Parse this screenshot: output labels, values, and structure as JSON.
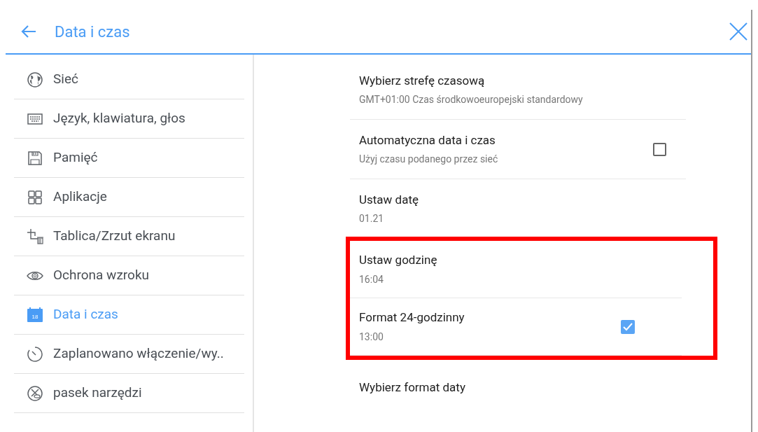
{
  "header": {
    "title": "Data i czas"
  },
  "sidebar": {
    "items": [
      {
        "label": "Sieć",
        "selected": false
      },
      {
        "label": "Język, klawiatura, głos",
        "selected": false
      },
      {
        "label": "Pamięć",
        "selected": false
      },
      {
        "label": "Aplikacje",
        "selected": false
      },
      {
        "label": "Tablica/Zrzut ekranu",
        "selected": false
      },
      {
        "label": "Ochrona wzroku",
        "selected": false
      },
      {
        "label": "Data i czas",
        "selected": true,
        "icon_text": "18"
      },
      {
        "label": "Zaplanowano włączenie/wy..",
        "selected": false
      },
      {
        "label": "pasek narzędzi",
        "selected": false
      }
    ]
  },
  "settings": [
    {
      "kind": "text",
      "title": "Wybierz strefę czasową",
      "subtitle": "GMT+01:00 Czas środkowoeuropejski standardowy",
      "highlighted": false
    },
    {
      "kind": "checkbox",
      "title": "Automatyczna data i czas",
      "subtitle": "Użyj czasu podanego przez sieć",
      "checked": false,
      "highlighted": false
    },
    {
      "kind": "text",
      "title": "Ustaw datę",
      "subtitle": "01.21",
      "highlighted": false
    },
    {
      "kind": "text",
      "title": "Ustaw godzinę",
      "subtitle": "16:04",
      "highlighted": true
    },
    {
      "kind": "checkbox",
      "title": "Format 24-godzinny",
      "subtitle": "13:00",
      "checked": true,
      "highlighted": true
    },
    {
      "kind": "text",
      "title": "Wybierz format daty",
      "highlighted": false
    }
  ]
}
